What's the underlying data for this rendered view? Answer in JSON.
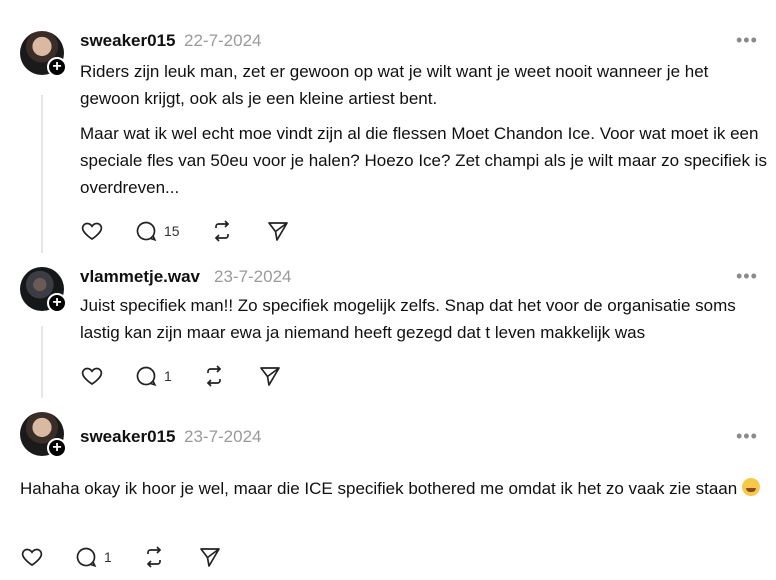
{
  "posts": [
    {
      "username": "sweaker015",
      "date": "22-7-2024",
      "more": "•••",
      "paragraphs": [
        "Riders zijn leuk man, zet er gewoon op wat je wilt want je weet nooit wanneer je het gewoon krijgt, ook als je een kleine artiest bent.",
        "Maar wat ik wel echt moe vindt zijn al die flessen Moet Chandon Ice. Voor wat moet ik een speciale fles van 50eu voor je halen? Hoezo Ice? Zet champi als je wilt maar zo specifiek is overdreven..."
      ],
      "reply_count": "15"
    },
    {
      "username": "vlammetje.wav",
      "date": "23-7-2024",
      "more": "•••",
      "paragraphs": [
        "Juist specifiek man!! Zo specifiek mogelijk zelfs. Snap dat het voor de organisatie soms lastig kan zijn maar ewa ja niemand heeft gezegd dat t leven makkelijk was"
      ],
      "reply_count": "1"
    },
    {
      "username": "sweaker015",
      "date": "23-7-2024",
      "more": "•••",
      "paragraphs": [
        "Hahaha okay ik hoor je wel, maar die ICE specifiek bothered me omdat ik het zo vaak zie staan"
      ],
      "reply_count": "1"
    }
  ],
  "icons": {
    "like": "heart-icon",
    "reply": "comment-icon",
    "repost": "repost-icon",
    "share": "send-icon",
    "follow": "plus-icon",
    "menu": "more-icon",
    "emoji": "grinning-sweat-emoji"
  },
  "colors": {
    "text": "#101010",
    "muted": "#9a9a9a",
    "line": "#e5e5e5"
  }
}
